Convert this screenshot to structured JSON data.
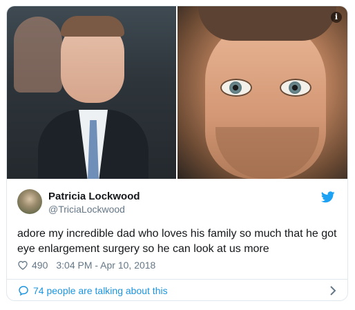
{
  "tweet": {
    "display_name": "Patricia Lockwood",
    "handle": "@TriciaLockwood",
    "text": "adore my incredible dad who loves his family so much that he got eye enlargement surgery so he can look at us more",
    "likes": "490",
    "timestamp": "3:04 PM - Apr 10, 2018"
  },
  "footer": {
    "talking_label": "74 people are talking about this"
  },
  "media": {
    "info_glyph": "i"
  },
  "icons": {
    "brand": "twitter-bird-icon",
    "like": "heart-icon",
    "conversation": "speech-bubble-icon",
    "more": "chevron-right-icon",
    "info": "info-icon"
  },
  "colors": {
    "twitter_blue": "#1da1f2",
    "link_blue": "#1b95e0",
    "text_primary": "#14171a",
    "text_secondary": "#657786",
    "border": "#e1e8ed"
  }
}
